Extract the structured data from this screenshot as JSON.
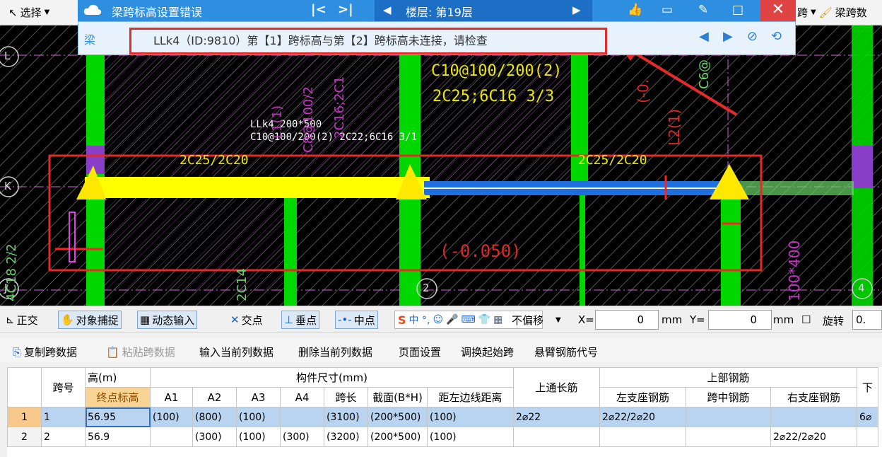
{
  "toolbar": {
    "select_label": "选择",
    "right_text_1": "跨",
    "right_text_2": "梁跨数"
  },
  "cad": {
    "grid_labels": [
      "L",
      "K",
      "J",
      "2",
      "4"
    ],
    "annotation_1": "C10@100/200(2)",
    "annotation_2": "2C25;6C16 3/3",
    "annotation_3": "LLk4 200*500",
    "annotation_4": "C10@100/200(2) 2C22;6C16 3/1",
    "annotation_5": "2C25/2C20",
    "annotation_6": "2C25/2C20",
    "annotation_7": "(-0.050)",
    "annotation_8": "2C16;2C1",
    "annotation_9": "C8@100/2",
    "annotation_10": "L1(1)",
    "annotation_11": "L2(1)",
    "annotation_12": "(-0.",
    "annotation_13": "4C18 2/2",
    "annotation_14": "100*400",
    "annotation_15": "C6@",
    "annotation_16": "2C14"
  },
  "popup": {
    "title": "梁跨标高设置错误",
    "floor_label": "楼层: 第19层",
    "close_label": "✕",
    "type_label": "梁",
    "message": "LLk4（ID:9810）第【1】跨标高与第【2】跨标高未连接，请检查"
  },
  "snap_bar": {
    "ortho_label": "正交",
    "snap_label": "对象捕捉",
    "dynamic_label": "动态输入",
    "intersect_label": "交点",
    "perp_label": "垂点",
    "mid_label": "中点",
    "ime_text": "中 °,",
    "offset_label": "不偏移",
    "x_label": "X=",
    "x_value": "0",
    "mm_label_1": "mm",
    "y_label": "Y=",
    "y_value": "0",
    "mm_label_2": "mm",
    "rotate_label": "旋转",
    "rotate_value": "0."
  },
  "table_bar": {
    "copy_span": "复制跨数据",
    "paste_span": "粘贴跨数据",
    "input_col": "输入当前列数据",
    "delete_col": "删除当前列数据",
    "page_setup": "页面设置",
    "swap_start": "调换起始跨",
    "cantilever": "悬臂钢筋代号"
  },
  "table": {
    "headers": {
      "span_no": "跨号",
      "elev_group": "高(m)",
      "end_elev": "终点标高",
      "size_group": "构件尺寸(mm)",
      "a1": "A1",
      "a2": "A2",
      "a3": "A3",
      "a4": "A4",
      "span_len": "跨长",
      "section": "截面(B*H)",
      "dist_left": "距左边线距离",
      "top_through": "上通长筋",
      "top_group": "上部钢筋",
      "left_seat": "左支座钢筋",
      "mid_span": "跨中钢筋",
      "right_seat": "右支座钢筋",
      "extra": "下"
    },
    "rows": [
      {
        "idx": "1",
        "span": "1",
        "end_elev": "56.95",
        "a1": "(100)",
        "a2": "(800)",
        "a3": "(100)",
        "a4": "",
        "span_len": "(3100)",
        "section": "(200*500)",
        "dist_left": "(100)",
        "top_through": "2⌀22",
        "left_seat": "2⌀22/2⌀20",
        "mid_span": "",
        "right_seat": "",
        "extra": "6⌀"
      },
      {
        "idx": "2",
        "span": "2",
        "end_elev": "56.9",
        "a1": "",
        "a2": "(300)",
        "a3": "(100)",
        "a4": "(300)",
        "span_len": "(3200)",
        "section": "(200*500)",
        "dist_left": "(100)",
        "top_through": "",
        "left_seat": "",
        "mid_span": "",
        "right_seat": "2⌀22/2⌀20",
        "extra": ""
      }
    ]
  },
  "colors": {
    "accent": "#2e8fe0",
    "highlight_box": "#e62a2a",
    "beam_yellow": "#ffff00",
    "column_green": "#00e000",
    "annotation_magenta": "#cc33cc"
  }
}
